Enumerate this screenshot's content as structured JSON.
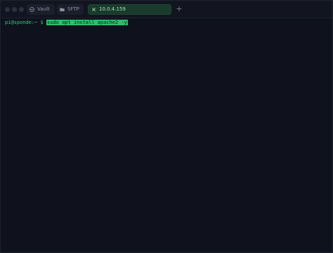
{
  "tabs": [
    {
      "label": "Vault",
      "icon": "vault-icon"
    },
    {
      "label": "SFTP",
      "icon": "folder-icon"
    },
    {
      "label": "10.0.4.159",
      "icon": "terminal-close-icon",
      "active": true
    }
  ],
  "new_tab_label": "+",
  "terminal": {
    "prompt": "pi@sponde:~ $",
    "command": "sudo apt install apache2 -y"
  },
  "colors": {
    "background": "#0f121d",
    "accent": "#2fbf6b",
    "prompt": "#3ec879"
  }
}
